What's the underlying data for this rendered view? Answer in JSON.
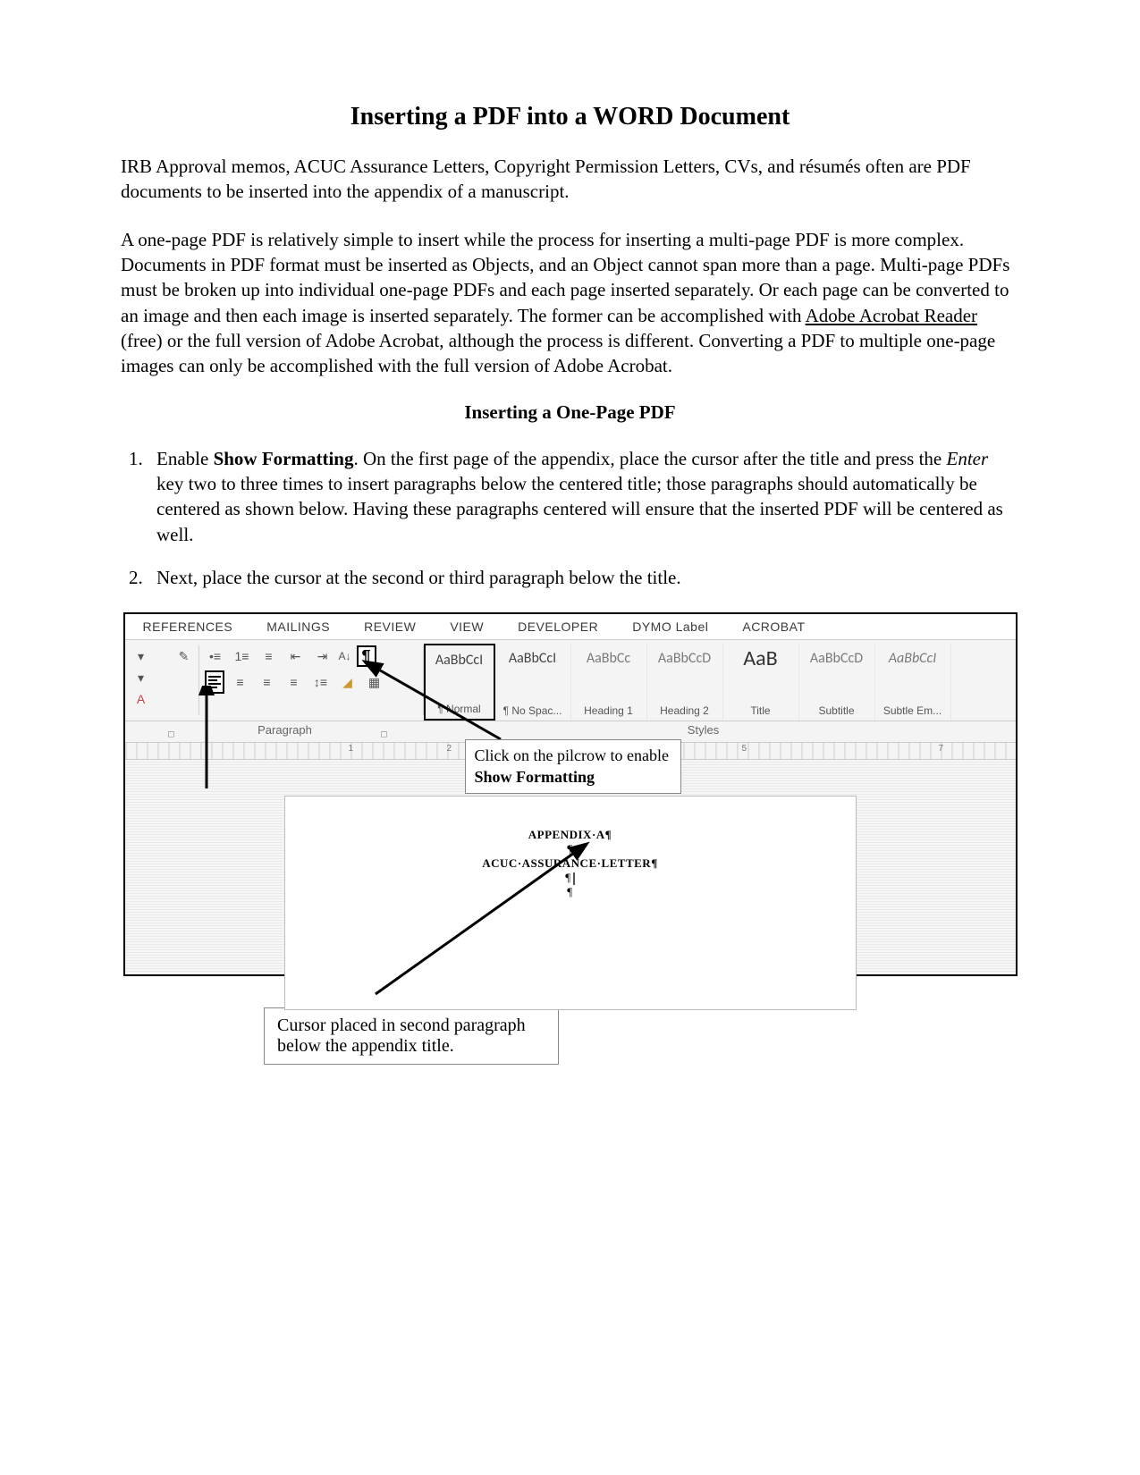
{
  "title": "Inserting a PDF into a WORD Document",
  "intro1": "IRB Approval memos, ACUC Assurance Letters, Copyright Permission Letters, CVs, and résumés often are PDF documents to be inserted into the appendix of a manuscript.",
  "intro2_a": "A one-page PDF is relatively simple to insert while the process for inserting a multi-page PDF is more complex. Documents in PDF format must be inserted as Objects, and an Object cannot span more than a page. Multi-page PDFs must be broken up into individual one-page PDFs and each page inserted separately. Or each page can be converted to an image and then each image is inserted separately. The former can be accomplished with ",
  "intro2_link": "Adobe Acrobat Reader",
  "intro2_b": " (free) or the full version of Adobe Acrobat, although the process is different. Converting a PDF to multiple one-page images can only be accomplished with the full version of Adobe Acrobat.",
  "subhead": "Inserting a One-Page PDF",
  "step1_a": "Enable ",
  "step1_bold": "Show Formatting",
  "step1_b": ". On the first page of the appendix, place the cursor after the title and press the ",
  "step1_italic": "Enter",
  "step1_c": " key two to three times to insert paragraphs below the centered title; those paragraphs should automatically be centered as shown below. Having these paragraphs centered will ensure that the inserted PDF will be centered as well.",
  "step2": "Next, place the cursor at the second or third paragraph below the title.",
  "ribbon": {
    "tabs": [
      "REFERENCES",
      "MAILINGS",
      "REVIEW",
      "VIEW",
      "DEVELOPER",
      "DYMO Label",
      "ACROBAT"
    ],
    "group_paragraph": "Paragraph",
    "group_styles": "Styles",
    "pilcrow": "¶",
    "styles": [
      {
        "sample": "AaBbCcI",
        "label": "¶ Normal",
        "selected": true,
        "cls": ""
      },
      {
        "sample": "AaBbCcI",
        "label": "¶ No Spac...",
        "selected": false,
        "cls": ""
      },
      {
        "sample": "AaBbCc",
        "label": "Heading 1",
        "selected": false,
        "cls": "gray"
      },
      {
        "sample": "AaBbCcD",
        "label": "Heading 2",
        "selected": false,
        "cls": "gray"
      },
      {
        "sample": "AaB",
        "label": "Title",
        "selected": false,
        "cls": "big"
      },
      {
        "sample": "AaBbCcD",
        "label": "Subtitle",
        "selected": false,
        "cls": "gray"
      },
      {
        "sample": "AaBbCcI",
        "label": "Subtle Em...",
        "selected": false,
        "cls": "italic"
      }
    ],
    "doc_line1": "APPENDIX·A¶",
    "doc_p": "¶",
    "doc_line2": "ACUC·ASSURANCE·LETTER¶"
  },
  "callout1_a": "Click on the pilcrow to enable ",
  "callout1_bold": "Show Formatting",
  "callout2": "Cursor placed in second paragraph below the appendix title."
}
